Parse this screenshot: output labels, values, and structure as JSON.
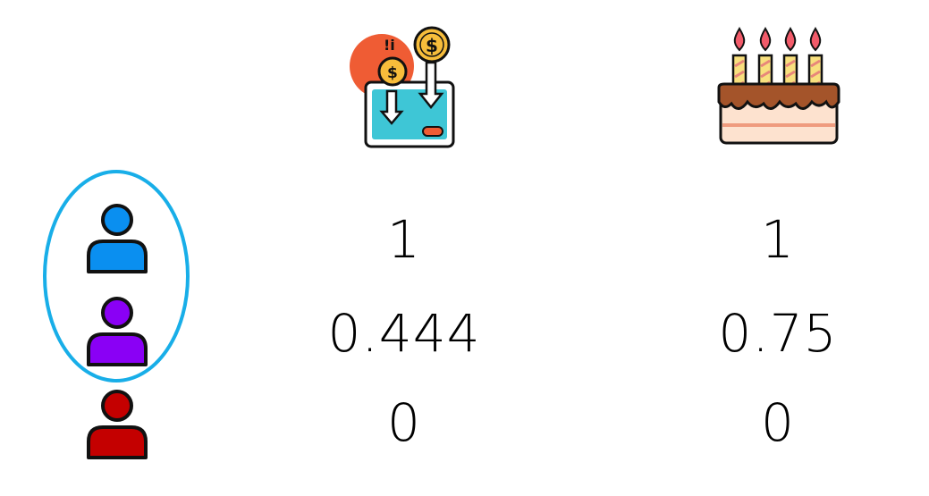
{
  "columns": [
    {
      "icon": "money-wallet-icon"
    },
    {
      "icon": "birthday-cake-icon"
    }
  ],
  "people": [
    {
      "icon": "person-icon",
      "color": "#0a8ff0"
    },
    {
      "icon": "person-icon",
      "color": "#8a00f5"
    },
    {
      "icon": "person-icon",
      "color": "#c40000"
    }
  ],
  "group_highlight": {
    "color": "#18aee8",
    "members": [
      0,
      1
    ]
  },
  "values": [
    [
      "1",
      "1"
    ],
    [
      "0.444",
      "0.75"
    ],
    [
      "0",
      "0"
    ]
  ]
}
